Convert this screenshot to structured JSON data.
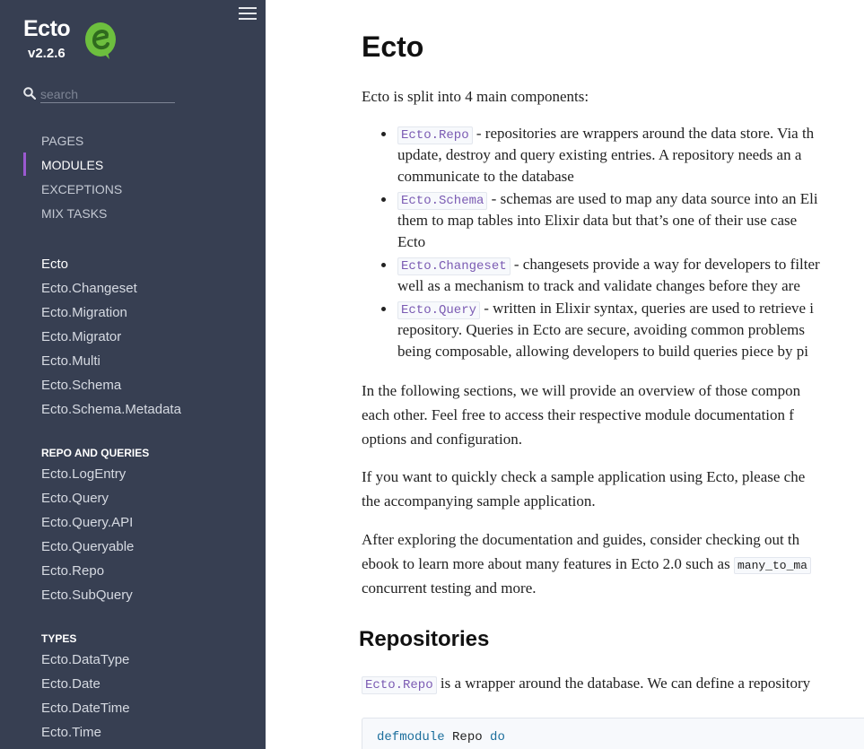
{
  "sidebar": {
    "project_name": "Ecto",
    "version": "v2.2.6",
    "search_placeholder": "search",
    "tabs": [
      {
        "label": "PAGES"
      },
      {
        "label": "MODULES"
      },
      {
        "label": "EXCEPTIONS"
      },
      {
        "label": "MIX TASKS"
      }
    ],
    "active_tab": "MODULES",
    "modules": [
      "Ecto",
      "Ecto.Changeset",
      "Ecto.Migration",
      "Ecto.Migrator",
      "Ecto.Multi",
      "Ecto.Schema",
      "Ecto.Schema.Metadata"
    ],
    "groups": [
      {
        "title": "REPO AND QUERIES",
        "items": [
          "Ecto.LogEntry",
          "Ecto.Query",
          "Ecto.Query.API",
          "Ecto.Queryable",
          "Ecto.Repo",
          "Ecto.SubQuery"
        ]
      },
      {
        "title": "TYPES",
        "items": [
          "Ecto.DataType",
          "Ecto.Date",
          "Ecto.DateTime",
          "Ecto.Time"
        ]
      }
    ],
    "colors": {
      "background": "#373f52",
      "accent": "#9b59d0",
      "logo_green": "#6dbf3e"
    },
    "icons": {
      "menu": "hamburger-icon",
      "search": "search-icon",
      "logo": "ecto-logo"
    }
  },
  "content": {
    "title": "Ecto",
    "intro": "Ecto is split into 4 main components:",
    "components": [
      {
        "code": "Ecto.Repo",
        "lines": [
          " - repositories are wrappers around the data store. Via th",
          "update, destroy and query existing entries. A repository needs an a",
          "communicate to the database"
        ]
      },
      {
        "code": "Ecto.Schema",
        "lines": [
          " - schemas are used to map any data source into an Eli",
          "them to map tables into Elixir data but that’s one of their use case",
          "Ecto"
        ]
      },
      {
        "code": "Ecto.Changeset",
        "lines": [
          " - changesets provide a way for developers to filter",
          "well as a mechanism to track and validate changes before they are"
        ]
      },
      {
        "code": "Ecto.Query",
        "lines": [
          " - written in Elixir syntax, queries are used to retrieve i",
          "repository. Queries in Ecto are secure, avoiding common problems",
          "being composable, allowing developers to build queries piece by pi"
        ]
      }
    ],
    "para1": [
      "In the following sections, we will provide an overview of those compon",
      "each other. Feel free to access their respective module documentation f",
      "options and configuration."
    ],
    "para2": [
      "If you want to quickly check a sample application using Ecto, please che",
      "the accompanying sample application."
    ],
    "para3_line1": "After exploring the documentation and guides, consider checking out th",
    "para3_line2_pre": "ebook to learn more about many features in Ecto 2.0 such as ",
    "para3_line2_code": "many_to_ma",
    "para3_line3": "concurrent testing and more.",
    "section_title": "Repositories",
    "repo_code": "Ecto.Repo",
    "repo_text": " is a wrapper around the database. We can define a repository",
    "code_block": {
      "kw1": "defmodule",
      "mod": "Repo",
      "kw2": "do"
    }
  }
}
